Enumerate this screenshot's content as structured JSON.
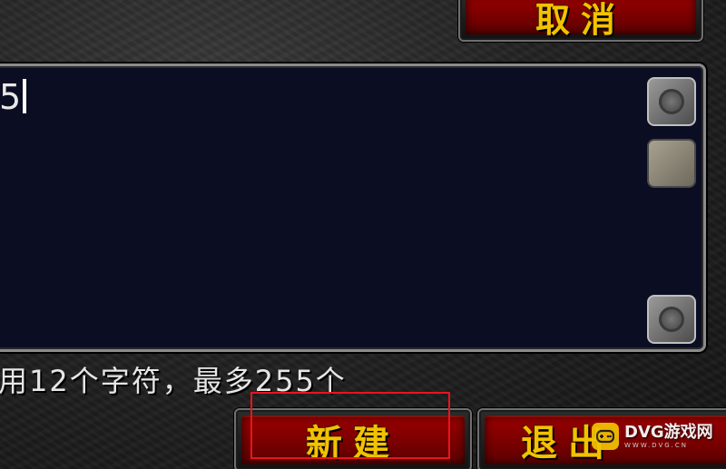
{
  "buttons": {
    "cancel_label": "取消",
    "create_label": "新建",
    "exit_label": "退出"
  },
  "editor": {
    "text": "5"
  },
  "hint": {
    "text": "用12个字符，最多255个"
  },
  "watermark": {
    "name": "DVG游戏网",
    "url": "WWW.DVG.CN"
  },
  "colors": {
    "button_red": "#8a0000",
    "button_text_gold": "#f2c200",
    "editor_bg": "#0b0d22",
    "annotation_red": "#e8141e",
    "watermark_yellow": "#f3c400"
  },
  "icons": {
    "scroll_up": "scroll-up-arrow-icon",
    "scroll_down": "scroll-down-arrow-icon",
    "watermark_logo": "gamepad-icon"
  }
}
